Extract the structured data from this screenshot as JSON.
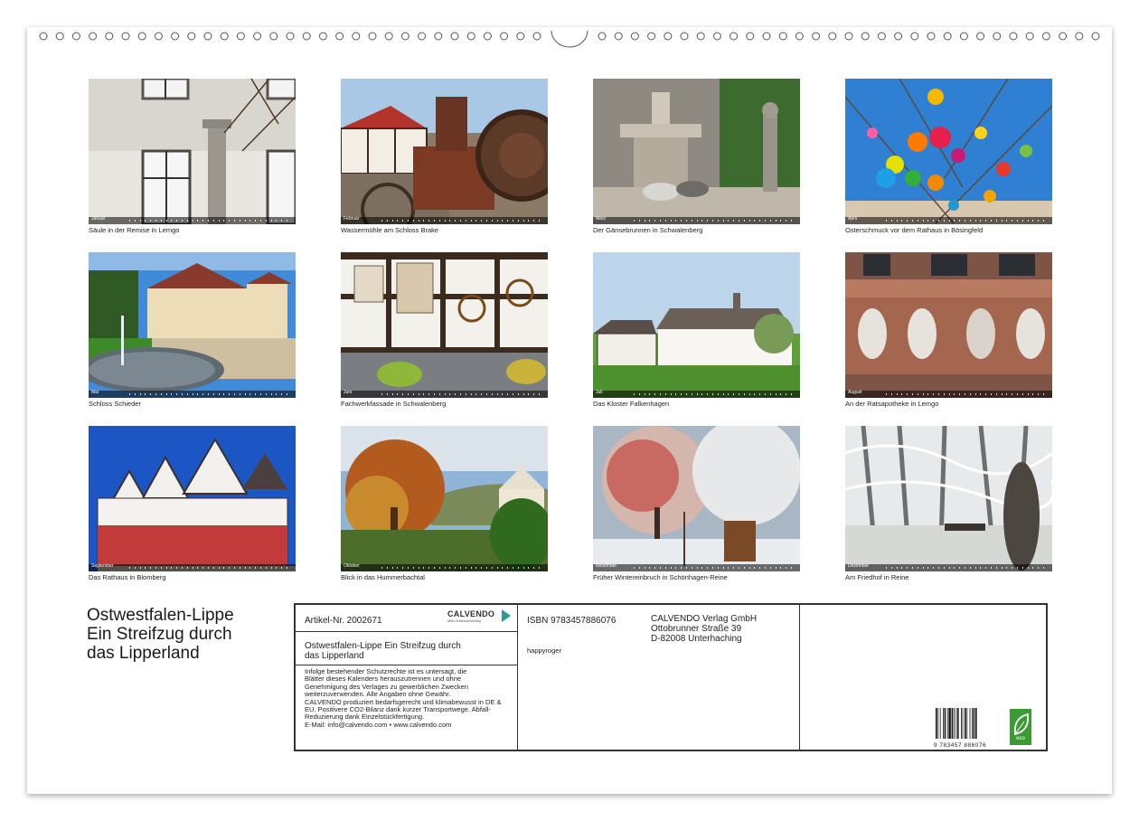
{
  "photos": [
    {
      "caption": "Säule in der Remise in Lemgo",
      "month": "Januar"
    },
    {
      "caption": "Wassermühle am Schloss Brake",
      "month": "Februar"
    },
    {
      "caption": "Der Gänsebrunnen in Schwalenberg",
      "month": "März"
    },
    {
      "caption": "Osterschmuck vor dem Rathaus in Bösingfeld",
      "month": "April"
    },
    {
      "caption": "Schloss Schieder",
      "month": "Mai"
    },
    {
      "caption": "Fachwerkfassade in Schwalenberg",
      "month": "Juni"
    },
    {
      "caption": "Das Kloster Falkenhagen",
      "month": "Juli"
    },
    {
      "caption": "An der Ratsapotheke in Lemgo",
      "month": "August"
    },
    {
      "caption": "Das Rathaus in Blomberg",
      "month": "September"
    },
    {
      "caption": "Blick in das Hummerbachtal",
      "month": "Oktober"
    },
    {
      "caption": "Früher Wintereinbruch in Schönhagen-Reine",
      "month": "November"
    },
    {
      "caption": "Am Friedhof in Reine",
      "month": "Dezember"
    }
  ],
  "title": {
    "line1": "Ostwestfalen-Lippe",
    "line2": "Ein Streifzug durch",
    "line3": "das Lipperland"
  },
  "info": {
    "article": "Artikel-Nr. 2002671",
    "logo_name": "CALVENDO",
    "logo_tag": "Mein Kalenderverlag",
    "book_title_1": "Ostwestfalen-Lippe Ein Streifzug durch",
    "book_title_2": "das Lipperland",
    "legal": [
      "Infolge bestehender Schutzrechte ist es untersagt, die",
      "Blätter dieses Kalenders herauszutrennen und ohne",
      "Genehmigung des Verlages zu gewerblichen Zwecken",
      "weiterzuverwenden. Alle Angaben ohne Gewähr.",
      "CALVENDO produziert bedarfsgerecht und klimabewusst in DE &",
      "EU. Positivere CO2-Bilanz dank kurzer Transportwege. Abfall-",
      "Reduzierung dank Einzelstückfertigung.",
      "E-Mail: info@calvendo.com • www.calvendo.com"
    ],
    "isbn": "ISBN 9783457886076",
    "author": "happyroger",
    "publisher_1": "CALVENDO Verlag GmbH",
    "publisher_2": "Ottobrunner Straße 39",
    "publisher_3": "D-82008 Unterhaching",
    "barcode_digits": "9 783457 886076",
    "eco_label": "eco"
  },
  "colors": {
    "eco_green": "#3c9a35",
    "calvendo_teal": "#2a9d8f"
  }
}
